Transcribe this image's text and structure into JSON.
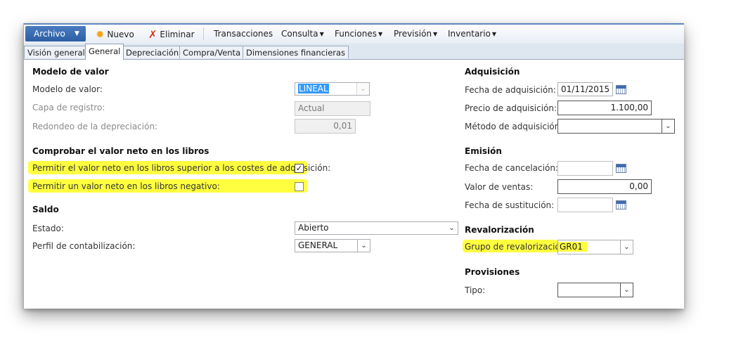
{
  "toolbar": {
    "archivo": "Archivo",
    "nuevo": "Nuevo",
    "eliminar": "Eliminar",
    "transacciones": "Transacciones",
    "consulta": "Consulta",
    "funciones": "Funciones",
    "prevision": "Previsión",
    "inventario": "Inventario",
    "icons": {
      "nuevo": "sun-star-icon",
      "eliminar": "red-x-icon"
    }
  },
  "tabs": [
    "Visión general",
    "General",
    "Depreciación",
    "Compra/Venta",
    "Dimensiones financieras"
  ],
  "active_tab": "General",
  "left": {
    "modelo_group": "Modelo de valor",
    "modelo_label": "Modelo de valor:",
    "modelo_value": "LINEAL",
    "capa_label": "Capa de registro:",
    "capa_value": "Actual",
    "redondeo_label": "Redondeo de la depreciación:",
    "redondeo_value": "0,01",
    "comprobar_group": "Comprobar el valor neto en los libros",
    "permitir_superior_label": "Permitir el valor neto en los libros superior a los costes de adquisición:",
    "permitir_superior_checked": true,
    "permitir_negativo_label": "Permitir un valor neto en los libros negativo:",
    "permitir_negativo_checked": false,
    "saldo_group": "Saldo",
    "estado_label": "Estado:",
    "estado_value": "Abierto",
    "perfil_label": "Perfil de contabilización:",
    "perfil_value": "GENERAL"
  },
  "right": {
    "adquisicion_group": "Adquisición",
    "fecha_adq_label": "Fecha de adquisición:",
    "fecha_adq_value": "01/11/2015",
    "precio_adq_label": "Precio de adquisición:",
    "precio_adq_value": "1.100,00",
    "metodo_adq_label": "Método de adquisición:",
    "metodo_adq_value": "",
    "emision_group": "Emisión",
    "fecha_cancel_label": "Fecha de cancelación:",
    "fecha_cancel_value": "",
    "valor_ventas_label": "Valor de ventas:",
    "valor_ventas_value": "0,00",
    "fecha_sust_label": "Fecha de sustitución:",
    "fecha_sust_value": "",
    "revalorizacion_group": "Revalorización",
    "grupo_reval_label": "Grupo de revalorización:",
    "grupo_reval_value": "GR01",
    "provisiones_group": "Provisiones",
    "tipo_label": "Tipo:",
    "tipo_value": ""
  },
  "colors": {
    "highlight": "#ffff40",
    "accent": "#2c5ea3",
    "selection": "#3399ff"
  }
}
